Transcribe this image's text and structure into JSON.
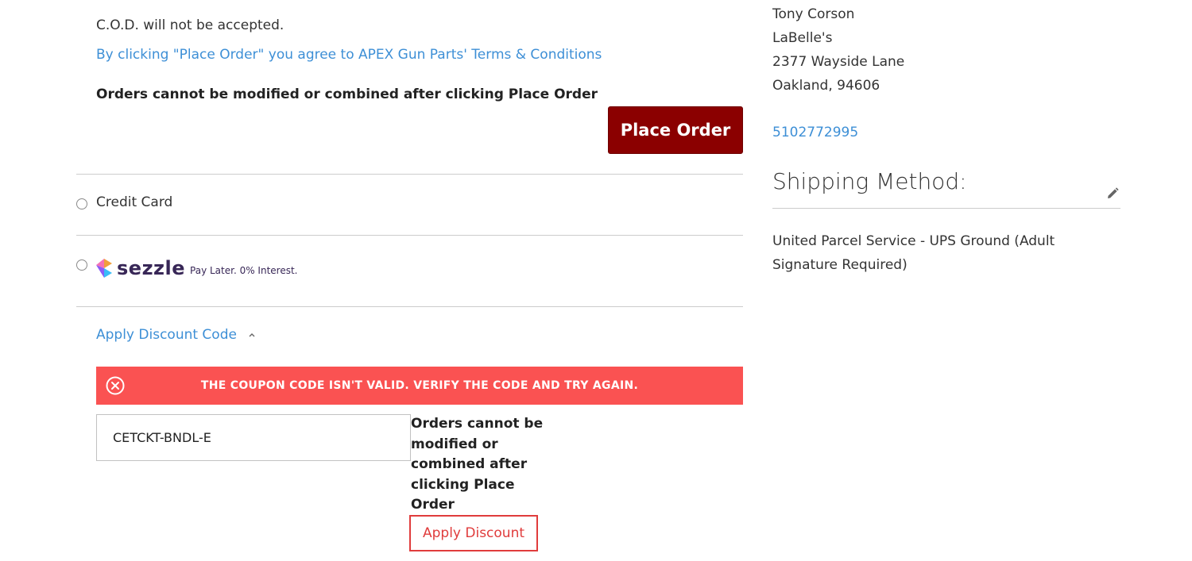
{
  "payment": {
    "cod_note": "C.O.D. will not be accepted.",
    "terms_link": "By clicking \"Place Order\" you agree to APEX Gun Parts' Terms & Conditions",
    "warning": "Orders cannot be modified or combined after clicking Place Order",
    "place_order_label": "Place Order",
    "methods": [
      {
        "label": "Credit Card",
        "selected": false
      },
      {
        "label": "sezzle",
        "tagline": "Pay Later. 0% Interest.",
        "selected": false
      }
    ]
  },
  "discount": {
    "toggle_label": "Apply Discount Code",
    "expanded": true,
    "error_message": "THE COUPON CODE ISN'T VALID. VERIFY THE CODE AND TRY AGAIN.",
    "code_value": "CETCKT-BNDL-E",
    "warning": "Orders cannot be modified or combined after clicking Place Order",
    "apply_label": "Apply Discount"
  },
  "shipping_address": {
    "name": "Tony Corson",
    "company": "LaBelle's",
    "street": "2377 Wayside Lane",
    "city_zip": "Oakland, 94606",
    "phone": "5102772995"
  },
  "shipping_method": {
    "title": "Shipping Method:",
    "value": "United Parcel Service - UPS Ground (Adult Signature Required)"
  },
  "colors": {
    "place_order_bg": "#8b0000",
    "link": "#3d8fd6",
    "error_banner": "#fa5252",
    "apply_border": "#e03c3c",
    "sezzle_text": "#382757"
  },
  "icons": {
    "error": "close-circle-icon",
    "toggle": "chevron-up-icon",
    "edit": "pencil-icon",
    "sezzle": "sezzle-logo-icon"
  }
}
